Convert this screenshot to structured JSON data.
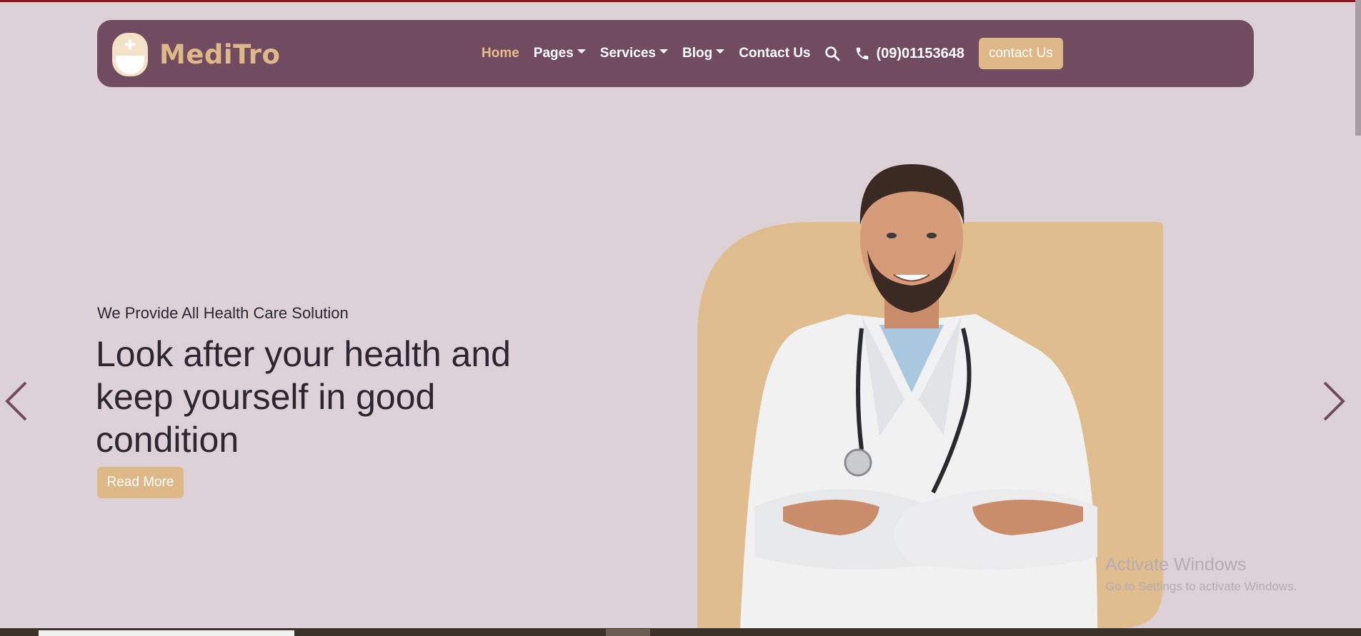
{
  "brand": {
    "name": "MediTro",
    "primary_color": "#714b5f",
    "accent_color": "#dfb887",
    "background_color": "#dcd1d6"
  },
  "nav": {
    "items": [
      {
        "label": "Home",
        "active": true,
        "dropdown": false
      },
      {
        "label": "Pages",
        "active": false,
        "dropdown": true
      },
      {
        "label": "Services",
        "active": false,
        "dropdown": true
      },
      {
        "label": "Blog",
        "active": false,
        "dropdown": true
      },
      {
        "label": "Contact Us",
        "active": false,
        "dropdown": false
      }
    ],
    "search_icon": "search-icon",
    "phone_icon": "phone-icon",
    "phone": "(09)01153648",
    "cta_label": "contact Us"
  },
  "hero": {
    "subtitle": "We Provide All Health Care Solution",
    "title": "Look after your health and keep yourself in good condition",
    "button_label": "Read More",
    "prev_icon": "chevron-left-icon",
    "next_icon": "chevron-right-icon"
  },
  "watermark": {
    "title": "Activate Windows",
    "subtitle": "Go to Settings to activate Windows."
  }
}
